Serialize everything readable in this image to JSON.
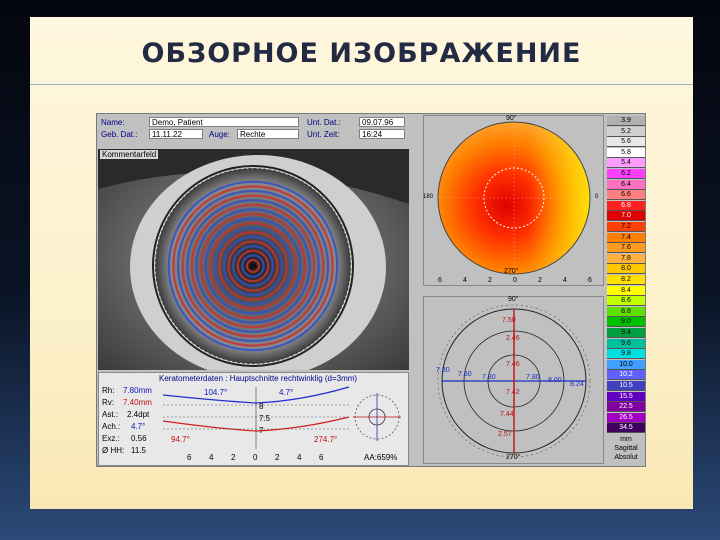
{
  "slide": {
    "title": "ОБЗОРНОЕ ИЗОБРАЖЕНИЕ"
  },
  "header": {
    "name_label": "Name:",
    "name_value": "Demo, Patient",
    "unt_dat_label": "Unt. Dat.:",
    "unt_dat_value": "09.07.96",
    "geb_label": "Geb. Dat.:",
    "geb_value": "11.11.22",
    "auge_label": "Auge:",
    "auge_value": "Rechte",
    "unt_zeit_label": "Unt. Zeit:",
    "unt_zeit_value": "16:24"
  },
  "eye": {
    "comment_label": "Kommentarfeld"
  },
  "kerato": {
    "title": "Keratometerdaten : Hauptschnitte rechtwinklig (d=3mm)",
    "rh_label": "Rh:",
    "rh_value": "7.80mm",
    "rv_label": "Rv:",
    "rv_value": "7.40mm",
    "ast_label": "Ast.:",
    "ast_value": "2.4dpt",
    "ach_label": "Ach.:",
    "ach_value": "4.7°",
    "exz_label": "Exz.:",
    "exz_value": "0.56",
    "hh_label": "Ø HH:",
    "hh_value": "11.5",
    "angle_104": "104.7°",
    "angle_4_7": "4.7°",
    "angle_94": "94.7°",
    "angle_274": "274.7°",
    "y_8": "8",
    "y_7_5": "7.5",
    "y_7": "7",
    "x_ticks": [
      "6",
      "4",
      "2",
      "0",
      "2",
      "4",
      "6"
    ],
    "aa": "AA:659%"
  },
  "map1": {
    "top_angle": "90°",
    "bottom_angle": "270°",
    "left_angle": "180",
    "right_angle": "0",
    "x_ticks": [
      "6",
      "4",
      "2",
      "0",
      "2",
      "4",
      "6"
    ]
  },
  "map2": {
    "top_angle": "90°",
    "bottom_angle": "270°",
    "vals": {
      "v1": "7.50",
      "v2": "2.46",
      "v3": "7.46",
      "v4": "7.42",
      "v5": "7.44",
      "v6": "2.57",
      "h1": "7.80",
      "h2": "7.80",
      "h3": "7.80",
      "h4": "7.80",
      "h5": "8.00",
      "h6": "8.24"
    },
    "x_ticks": [
      "6",
      "4",
      "2",
      "0",
      "2",
      "4",
      "6"
    ]
  },
  "scale": {
    "values": [
      "3.9",
      "5.2",
      "5.6",
      "5.8",
      "5.4",
      "6.2",
      "6.4",
      "6.6",
      "6.8",
      "7.0",
      "7.2",
      "7.4",
      "7.6",
      "7.8",
      "8.0",
      "8.2",
      "8.4",
      "8.6",
      "8.8",
      "9.0",
      "9.4",
      "9.6",
      "9.8",
      "10.0",
      "10.2",
      "10.5",
      "15.5",
      "22.5",
      "26.5",
      "34.5"
    ],
    "colors": [
      "#b0b0b0",
      "#d0d0d0",
      "#e8e8e8",
      "#ffffff",
      "#ff9cff",
      "#ff40ff",
      "#ff70c0",
      "#ff8080",
      "#ff2020",
      "#e00000",
      "#ff4000",
      "#ff8000",
      "#ff9a20",
      "#ffb040",
      "#ffc800",
      "#ffe000",
      "#ffff00",
      "#c0ff00",
      "#60e000",
      "#00c000",
      "#00a040",
      "#00c0a0",
      "#00e0e0",
      "#40a0ff",
      "#6060ff",
      "#4040c0",
      "#6000c0",
      "#8000a0",
      "#a000c0",
      "#400060"
    ],
    "unit": "mm",
    "mode1": "Sagittal",
    "mode2": "Absolut"
  }
}
